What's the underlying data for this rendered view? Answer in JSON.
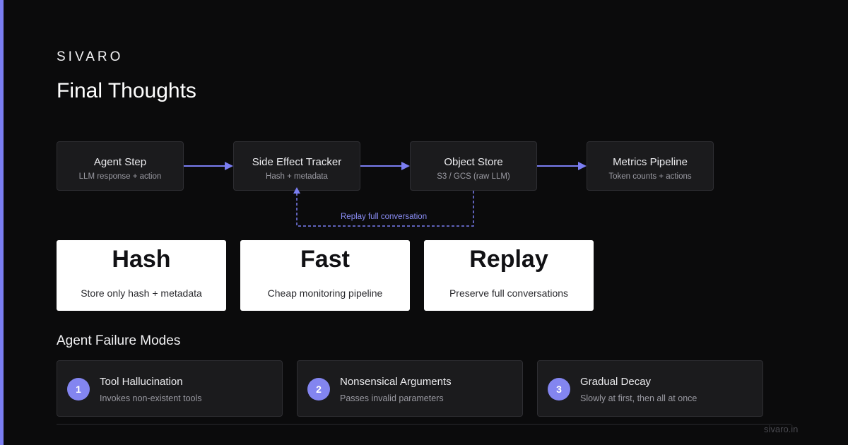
{
  "brand": "SIVARO",
  "title": "Final Thoughts",
  "flow": {
    "nodes": [
      {
        "title": "Agent Step",
        "subtitle": "LLM response + action"
      },
      {
        "title": "Side Effect Tracker",
        "subtitle": "Hash + metadata"
      },
      {
        "title": "Object Store",
        "subtitle": "S3 / GCS (raw LLM)"
      },
      {
        "title": "Metrics Pipeline",
        "subtitle": "Token counts + actions"
      }
    ],
    "replay_label": "Replay full conversation",
    "accent_color": "#7b7ef2"
  },
  "cards": [
    {
      "title": "Hash",
      "subtitle": "Store only hash + metadata"
    },
    {
      "title": "Fast",
      "subtitle": "Cheap monitoring pipeline"
    },
    {
      "title": "Replay",
      "subtitle": "Preserve full conversations"
    }
  ],
  "failure_modes": {
    "title": "Agent Failure Modes",
    "items": [
      {
        "number": "1",
        "title": "Tool Hallucination",
        "subtitle": "Invokes non-existent tools"
      },
      {
        "number": "2",
        "title": "Nonsensical Arguments",
        "subtitle": "Passes invalid parameters"
      },
      {
        "number": "3",
        "title": "Gradual Decay",
        "subtitle": "Slowly at first, then all at once"
      }
    ]
  },
  "footer": {
    "url": "sivaro.in"
  }
}
